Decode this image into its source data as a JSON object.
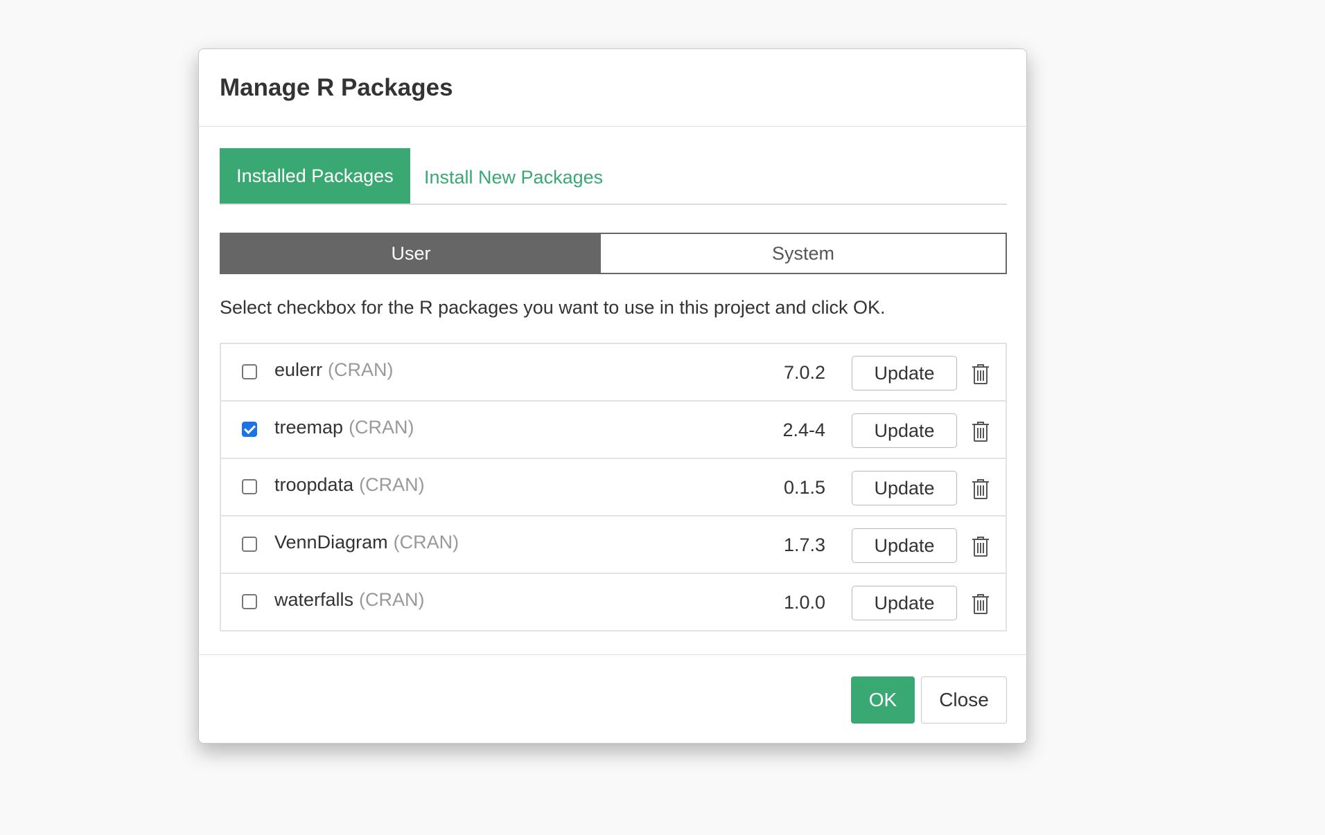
{
  "dialog": {
    "title": "Manage R Packages"
  },
  "tabs": {
    "installed_label": "Installed Packages",
    "install_new_label": "Install New Packages",
    "active": "installed"
  },
  "segment": {
    "user_label": "User",
    "system_label": "System",
    "active": "user"
  },
  "instruction": "Select checkbox for the R packages you want to use in this project and click OK.",
  "packages": [
    {
      "name": "eulerr",
      "source": "(CRAN)",
      "version": "7.0.2",
      "checked": false,
      "update_label": "Update"
    },
    {
      "name": "treemap",
      "source": "(CRAN)",
      "version": "2.4-4",
      "checked": true,
      "update_label": "Update"
    },
    {
      "name": "troopdata",
      "source": "(CRAN)",
      "version": "0.1.5",
      "checked": false,
      "update_label": "Update"
    },
    {
      "name": "VennDiagram",
      "source": "(CRAN)",
      "version": "1.7.3",
      "checked": false,
      "update_label": "Update"
    },
    {
      "name": "waterfalls",
      "source": "(CRAN)",
      "version": "1.0.0",
      "checked": false,
      "update_label": "Update"
    }
  ],
  "footer": {
    "ok_label": "OK",
    "close_label": "Close"
  },
  "colors": {
    "accent_green": "#3aa873",
    "segment_active": "#666666",
    "checkbox_checked": "#1a73e8"
  }
}
